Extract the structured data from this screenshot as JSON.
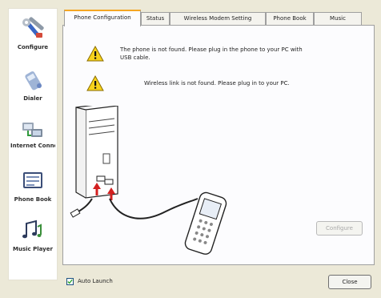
{
  "sidebar": {
    "items": [
      {
        "label": "Configure",
        "icon": "tools-icon"
      },
      {
        "label": "Dialer",
        "icon": "phone-icon"
      },
      {
        "label": "Internet Connection",
        "icon": "network-icon"
      },
      {
        "label": "Phone Book",
        "icon": "phonebook-icon"
      },
      {
        "label": "Music Player",
        "icon": "music-notes-icon"
      }
    ]
  },
  "tabs": [
    {
      "label": "Phone Configuration",
      "active": true
    },
    {
      "label": "Status",
      "active": false
    },
    {
      "label": "Wireless Modem Setting",
      "active": false
    },
    {
      "label": "Phone Book",
      "active": false
    },
    {
      "label": "Music",
      "active": false
    }
  ],
  "messages": [
    {
      "text": "The phone is not found. Please plug in the phone to your PC with USB cable.",
      "icon": "warning-icon"
    },
    {
      "text": "Wireless link is not found. Please plug in to your PC.",
      "icon": "warning-icon"
    }
  ],
  "buttons": {
    "configure": "Configure",
    "close": "Close"
  },
  "auto_launch": {
    "label": "Auto Launch",
    "checked": true
  },
  "colors": {
    "accent_tab": "#f5a623",
    "warning": "#f7d21c",
    "window_bg": "#ece9d8"
  }
}
